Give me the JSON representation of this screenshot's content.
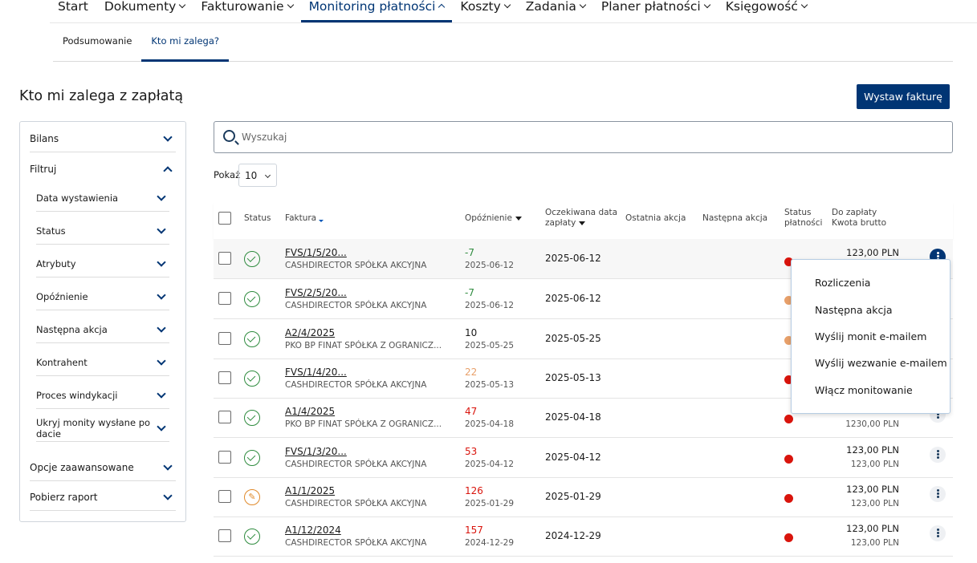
{
  "nav": [
    {
      "label": "Start",
      "chevron": false,
      "active": false
    },
    {
      "label": "Dokumenty",
      "chevron": true,
      "active": false
    },
    {
      "label": "Fakturowanie",
      "chevron": true,
      "active": false
    },
    {
      "label": "Monitoring płatności",
      "chevron": true,
      "active": true
    },
    {
      "label": "Koszty",
      "chevron": true,
      "active": false
    },
    {
      "label": "Zadania",
      "chevron": true,
      "active": false
    },
    {
      "label": "Planer płatności",
      "chevron": true,
      "active": false
    },
    {
      "label": "Księgowość",
      "chevron": true,
      "active": false
    }
  ],
  "subtabs": [
    {
      "label": "Podsumowanie",
      "active": false
    },
    {
      "label": "Kto mi zalega?",
      "active": true
    }
  ],
  "page": {
    "title": "Kto mi zalega z zapłatą",
    "issue_invoice_label": "Wystaw fakturę"
  },
  "filters": {
    "bilans": "Bilans",
    "filtruj": "Filtruj",
    "sub": [
      "Data wystawienia",
      "Status",
      "Atrybuty",
      "Opóźnienie",
      "Następna akcja",
      "Kontrahent",
      "Proces windykacji",
      "Ukryj monity wysłane po dacie"
    ],
    "advanced": "Opcje zaawansowane",
    "report": "Pobierz raport"
  },
  "search": {
    "placeholder": "Wyszukaj"
  },
  "page_size": {
    "label": "Pokaż",
    "value": "10"
  },
  "table": {
    "headers": {
      "status": "Status",
      "invoice": "Faktura",
      "delay": "Opóźnienie",
      "expected_l1": "Oczekiwana data",
      "expected_l2": "zapłaty",
      "last_action": "Ostatnia akcja",
      "next_action": "Następna akcja",
      "payment_status_l1": "Status",
      "payment_status_l2": "płatności",
      "due_l1": "Do zapłaty",
      "due_l2": "Kwota brutto"
    },
    "rows": [
      {
        "status": "ok",
        "invoice": "FVS/1/5/20...",
        "client": "CASHDIRECTOR SPÓŁKA AKCYJNA",
        "delay": "-7",
        "delay_date": "2025-06-12",
        "delay_color": "#2e8b3e",
        "expected": "2025-06-12",
        "dot_color": "#d9140c",
        "amount": "123,00 PLN",
        "gross": "",
        "kebab_active": true
      },
      {
        "status": "ok",
        "invoice": "FVS/2/5/20...",
        "client": "CASHDIRECTOR SPÓŁKA AKCYJNA",
        "delay": "-7",
        "delay_date": "2025-06-12",
        "delay_color": "#2e8b3e",
        "expected": "2025-06-12",
        "dot_color": "#e8a06a",
        "amount": "",
        "gross": "",
        "kebab_active": false
      },
      {
        "status": "ok",
        "invoice": "A2/4/2025",
        "client": "PKO BP FINAT SPÓŁKA Z OGRANICZ...",
        "delay": "10",
        "delay_date": "2025-05-25",
        "delay_color": "#1a1a1a",
        "expected": "2025-05-25",
        "dot_color": "#e8a06a",
        "amount": "",
        "gross": "",
        "kebab_active": false
      },
      {
        "status": "ok",
        "invoice": "FVS/1/4/20...",
        "client": "CASHDIRECTOR SPÓŁKA AKCYJNA",
        "delay": "22",
        "delay_date": "2025-05-13",
        "delay_color": "#e8a06a",
        "expected": "2025-05-13",
        "dot_color": "#d9140c",
        "amount": "",
        "gross": "",
        "kebab_active": false
      },
      {
        "status": "ok",
        "invoice": "A1/4/2025",
        "client": "PKO BP FINAT SPÓŁKA Z OGRANICZ...",
        "delay": "47",
        "delay_date": "2025-04-18",
        "delay_color": "#d9140c",
        "expected": "2025-04-18",
        "dot_color": "#d9140c",
        "amount": "",
        "gross": "1230,00 PLN",
        "kebab_active": false
      },
      {
        "status": "ok",
        "invoice": "FVS/1/3/20...",
        "client": "CASHDIRECTOR SPÓŁKA AKCYJNA",
        "delay": "53",
        "delay_date": "2025-04-12",
        "delay_color": "#d9140c",
        "expected": "2025-04-12",
        "dot_color": "#d9140c",
        "amount": "123,00 PLN",
        "gross": "123,00 PLN",
        "kebab_active": false
      },
      {
        "status": "edit",
        "invoice": "A1/1/2025",
        "client": "CASHDIRECTOR SPÓŁKA AKCYJNA",
        "delay": "126",
        "delay_date": "2025-01-29",
        "delay_color": "#d9140c",
        "expected": "2025-01-29",
        "dot_color": "#d9140c",
        "amount": "123,00 PLN",
        "gross": "123,00 PLN",
        "kebab_active": false
      },
      {
        "status": "ok",
        "invoice": "A1/12/2024",
        "client": "CASHDIRECTOR SPÓŁKA AKCYJNA",
        "delay": "157",
        "delay_date": "2024-12-29",
        "delay_color": "#d9140c",
        "expected": "2024-12-29",
        "dot_color": "#d9140c",
        "amount": "123,00 PLN",
        "gross": "123,00 PLN",
        "kebab_active": false
      }
    ]
  },
  "row_menu": [
    "Rozliczenia",
    "Następna akcja",
    "Wyślij monit e-mailem",
    "Wyślij wezwanie e-mailem",
    "Włącz monitowanie"
  ],
  "colors": {
    "brand": "#003574",
    "ok": "#2e8b3e",
    "warning": "#e8a06a",
    "danger": "#d9140c"
  }
}
